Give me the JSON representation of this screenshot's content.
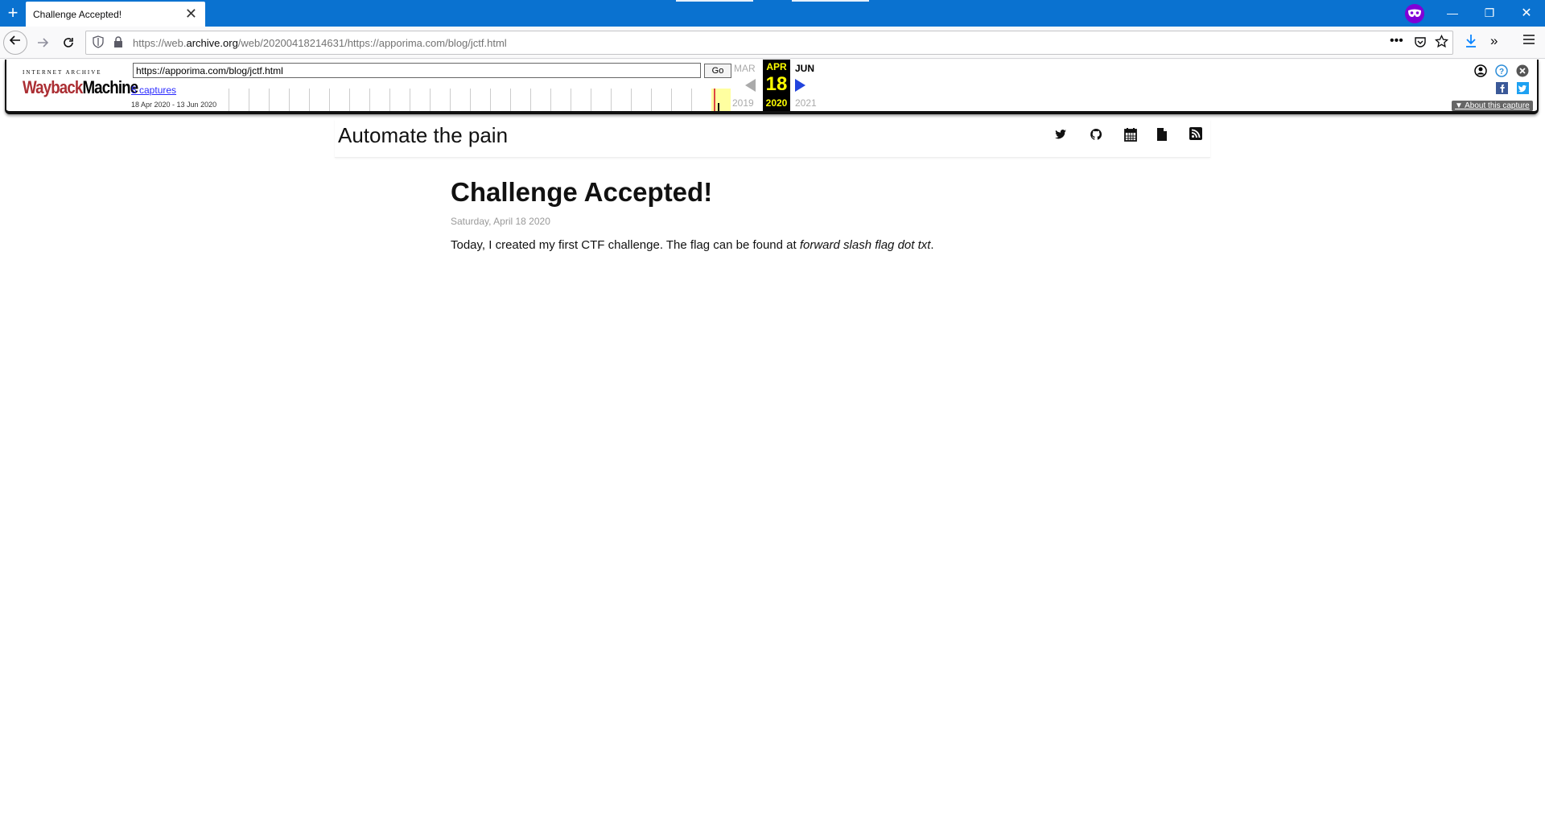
{
  "browser": {
    "tab_title": "Challenge Accepted!",
    "url_prefix": "https://web.",
    "url_domain": "archive.org",
    "url_suffix": "/web/20200418214631/https://apporima.com/blog/jctf.html"
  },
  "wayback": {
    "logo_top": "INTERNET ARCHIVE",
    "logo_red": "Wayback",
    "logo_black": "Machine",
    "input_url": "https://apporima.com/blog/jctf.html",
    "go_label": "Go",
    "captures_label": "5 captures",
    "range_label": "18 Apr 2020 - 13 Jun 2020",
    "prev_month": "MAR",
    "cur_month": "APR",
    "next_month": "JUN",
    "cur_day": "18",
    "prev_year": "2019",
    "cur_year": "2020",
    "next_year": "2021",
    "about_label": "▼ About this capture"
  },
  "site": {
    "title": "Automate the pain"
  },
  "post": {
    "title": "Challenge Accepted!",
    "date": "Saturday, April 18 2020",
    "body_before": "Today, I created my first CTF challenge. The flag can be found at ",
    "body_em": "forward slash flag dot txt",
    "body_after": "."
  }
}
